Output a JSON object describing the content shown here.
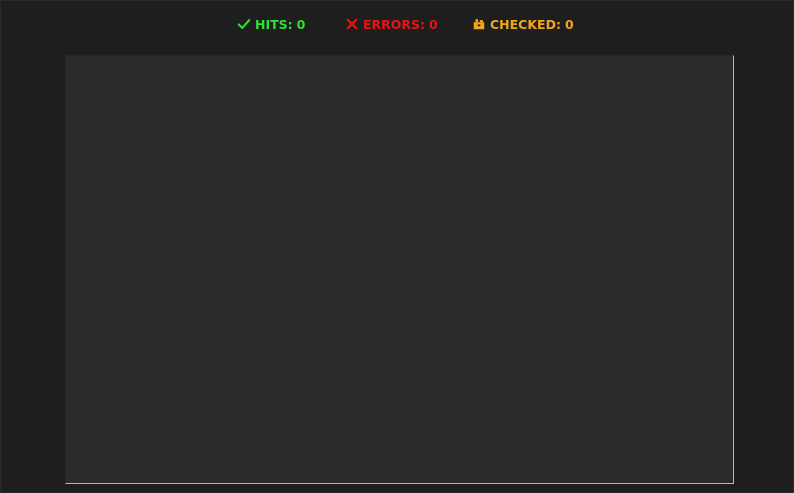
{
  "stats": {
    "hits": {
      "label": "HITS:",
      "value": "0",
      "color": "#2fe02f",
      "icon": "check-icon"
    },
    "errors": {
      "label": "ERRORS:",
      "value": "0",
      "color": "#ee1111",
      "icon": "close-icon"
    },
    "checked": {
      "label": "CHECKED:",
      "value": "0",
      "color": "#f0a61c",
      "icon": "package-icon"
    }
  },
  "colors": {
    "background": "#1e1e1e",
    "panel": "#2b2b2b",
    "panel_border": "#b8b8b8"
  }
}
